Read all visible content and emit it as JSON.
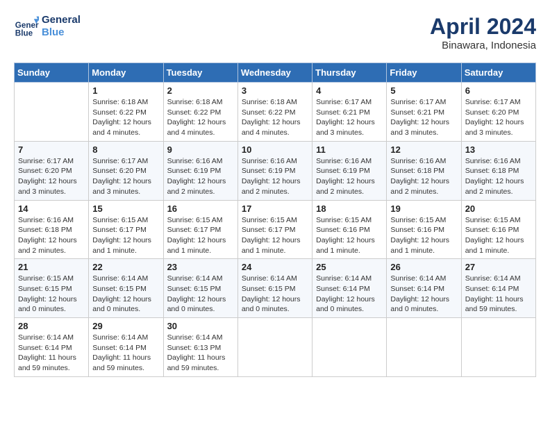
{
  "header": {
    "logo_line1": "General",
    "logo_line2": "Blue",
    "month_year": "April 2024",
    "location": "Binawara, Indonesia"
  },
  "columns": [
    "Sunday",
    "Monday",
    "Tuesday",
    "Wednesday",
    "Thursday",
    "Friday",
    "Saturday"
  ],
  "weeks": [
    [
      {
        "day": "",
        "sunrise": "",
        "sunset": "",
        "daylight": ""
      },
      {
        "day": "1",
        "sunrise": "6:18 AM",
        "sunset": "6:22 PM",
        "daylight": "12 hours and 4 minutes."
      },
      {
        "day": "2",
        "sunrise": "6:18 AM",
        "sunset": "6:22 PM",
        "daylight": "12 hours and 4 minutes."
      },
      {
        "day": "3",
        "sunrise": "6:18 AM",
        "sunset": "6:22 PM",
        "daylight": "12 hours and 4 minutes."
      },
      {
        "day": "4",
        "sunrise": "6:17 AM",
        "sunset": "6:21 PM",
        "daylight": "12 hours and 3 minutes."
      },
      {
        "day": "5",
        "sunrise": "6:17 AM",
        "sunset": "6:21 PM",
        "daylight": "12 hours and 3 minutes."
      },
      {
        "day": "6",
        "sunrise": "6:17 AM",
        "sunset": "6:20 PM",
        "daylight": "12 hours and 3 minutes."
      }
    ],
    [
      {
        "day": "7",
        "sunrise": "6:17 AM",
        "sunset": "6:20 PM",
        "daylight": "12 hours and 3 minutes."
      },
      {
        "day": "8",
        "sunrise": "6:17 AM",
        "sunset": "6:20 PM",
        "daylight": "12 hours and 3 minutes."
      },
      {
        "day": "9",
        "sunrise": "6:16 AM",
        "sunset": "6:19 PM",
        "daylight": "12 hours and 2 minutes."
      },
      {
        "day": "10",
        "sunrise": "6:16 AM",
        "sunset": "6:19 PM",
        "daylight": "12 hours and 2 minutes."
      },
      {
        "day": "11",
        "sunrise": "6:16 AM",
        "sunset": "6:19 PM",
        "daylight": "12 hours and 2 minutes."
      },
      {
        "day": "12",
        "sunrise": "6:16 AM",
        "sunset": "6:18 PM",
        "daylight": "12 hours and 2 minutes."
      },
      {
        "day": "13",
        "sunrise": "6:16 AM",
        "sunset": "6:18 PM",
        "daylight": "12 hours and 2 minutes."
      }
    ],
    [
      {
        "day": "14",
        "sunrise": "6:16 AM",
        "sunset": "6:18 PM",
        "daylight": "12 hours and 2 minutes."
      },
      {
        "day": "15",
        "sunrise": "6:15 AM",
        "sunset": "6:17 PM",
        "daylight": "12 hours and 1 minute."
      },
      {
        "day": "16",
        "sunrise": "6:15 AM",
        "sunset": "6:17 PM",
        "daylight": "12 hours and 1 minute."
      },
      {
        "day": "17",
        "sunrise": "6:15 AM",
        "sunset": "6:17 PM",
        "daylight": "12 hours and 1 minute."
      },
      {
        "day": "18",
        "sunrise": "6:15 AM",
        "sunset": "6:16 PM",
        "daylight": "12 hours and 1 minute."
      },
      {
        "day": "19",
        "sunrise": "6:15 AM",
        "sunset": "6:16 PM",
        "daylight": "12 hours and 1 minute."
      },
      {
        "day": "20",
        "sunrise": "6:15 AM",
        "sunset": "6:16 PM",
        "daylight": "12 hours and 1 minute."
      }
    ],
    [
      {
        "day": "21",
        "sunrise": "6:15 AM",
        "sunset": "6:15 PM",
        "daylight": "12 hours and 0 minutes."
      },
      {
        "day": "22",
        "sunrise": "6:14 AM",
        "sunset": "6:15 PM",
        "daylight": "12 hours and 0 minutes."
      },
      {
        "day": "23",
        "sunrise": "6:14 AM",
        "sunset": "6:15 PM",
        "daylight": "12 hours and 0 minutes."
      },
      {
        "day": "24",
        "sunrise": "6:14 AM",
        "sunset": "6:15 PM",
        "daylight": "12 hours and 0 minutes."
      },
      {
        "day": "25",
        "sunrise": "6:14 AM",
        "sunset": "6:14 PM",
        "daylight": "12 hours and 0 minutes."
      },
      {
        "day": "26",
        "sunrise": "6:14 AM",
        "sunset": "6:14 PM",
        "daylight": "12 hours and 0 minutes."
      },
      {
        "day": "27",
        "sunrise": "6:14 AM",
        "sunset": "6:14 PM",
        "daylight": "11 hours and 59 minutes."
      }
    ],
    [
      {
        "day": "28",
        "sunrise": "6:14 AM",
        "sunset": "6:14 PM",
        "daylight": "11 hours and 59 minutes."
      },
      {
        "day": "29",
        "sunrise": "6:14 AM",
        "sunset": "6:14 PM",
        "daylight": "11 hours and 59 minutes."
      },
      {
        "day": "30",
        "sunrise": "6:14 AM",
        "sunset": "6:13 PM",
        "daylight": "11 hours and 59 minutes."
      },
      {
        "day": "",
        "sunrise": "",
        "sunset": "",
        "daylight": ""
      },
      {
        "day": "",
        "sunrise": "",
        "sunset": "",
        "daylight": ""
      },
      {
        "day": "",
        "sunrise": "",
        "sunset": "",
        "daylight": ""
      },
      {
        "day": "",
        "sunrise": "",
        "sunset": "",
        "daylight": ""
      }
    ]
  ],
  "labels": {
    "sunrise_prefix": "Sunrise: ",
    "sunset_prefix": "Sunset: ",
    "daylight_prefix": "Daylight: "
  }
}
